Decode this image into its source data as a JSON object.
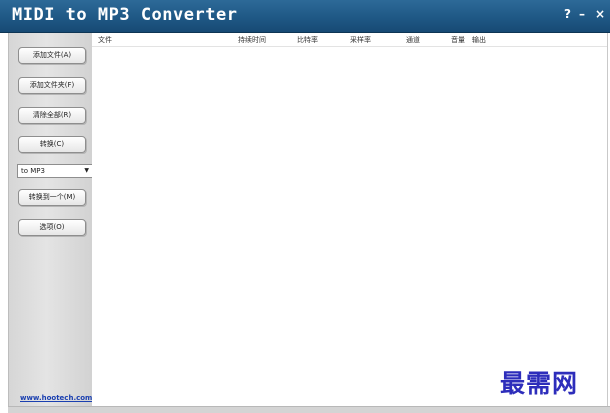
{
  "window": {
    "title": "MIDI to MP3 Converter",
    "controls": {
      "help": "?",
      "minimize": "–",
      "close": "×"
    }
  },
  "sidebar": {
    "buttons": [
      {
        "label": "添加文件(A)"
      },
      {
        "label": "添加文件夹(F)"
      },
      {
        "label": "清除全部(R)"
      },
      {
        "label": "转换(C)"
      },
      {
        "label": "转换到一个(M)"
      },
      {
        "label": "选项(O)"
      }
    ],
    "format_select": {
      "value": "to MP3"
    },
    "footer_link": "www.hootech.com"
  },
  "file_list": {
    "columns": [
      "文件",
      "持续时间",
      "比特率",
      "采样率",
      "通道",
      "音量",
      "输出"
    ],
    "rows": []
  },
  "watermark": "最需网",
  "colors": {
    "titlebar": "#1f5885",
    "sidebar": "#dcdcdc",
    "link": "#1a3fb0",
    "watermark": "#2d2dbb"
  }
}
